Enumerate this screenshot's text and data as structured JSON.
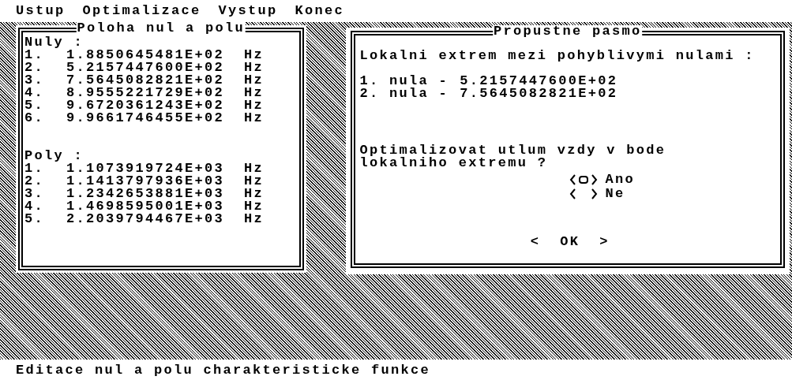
{
  "menu": [
    {
      "label": "Ustup"
    },
    {
      "label": "Optimalizace"
    },
    {
      "label": "Vystup"
    },
    {
      "label": "Konec"
    }
  ],
  "panel": {
    "title": "Poloha nul a polu",
    "sections": [
      {
        "heading": "Nuly :",
        "rows": [
          {
            "index": "1.",
            "value": "1.8850645481E+02",
            "unit": "Hz"
          },
          {
            "index": "2.",
            "value": "5.2157447600E+02",
            "unit": "Hz"
          },
          {
            "index": "3.",
            "value": "7.5645082821E+02",
            "unit": "Hz"
          },
          {
            "index": "4.",
            "value": "8.9555221729E+02",
            "unit": "Hz"
          },
          {
            "index": "5.",
            "value": "9.6720361243E+02",
            "unit": "Hz"
          },
          {
            "index": "6.",
            "value": "9.9661746455E+02",
            "unit": "Hz"
          }
        ]
      },
      {
        "heading": "Poly :",
        "rows": [
          {
            "index": "1.",
            "value": "1.1073919724E+03",
            "unit": "Hz"
          },
          {
            "index": "2.",
            "value": "1.1413797936E+03",
            "unit": "Hz"
          },
          {
            "index": "3.",
            "value": "1.2342653881E+03",
            "unit": "Hz"
          },
          {
            "index": "4.",
            "value": "1.4698595001E+03",
            "unit": "Hz"
          },
          {
            "index": "5.",
            "value": "2.2039794467E+03",
            "unit": "Hz"
          }
        ]
      }
    ]
  },
  "dialog": {
    "title": "Propustne pasmo",
    "message": "Lokalni extrem mezi pohyblivymi nulami :",
    "lines": [
      {
        "label": "1. nula -",
        "value": "5.2157447600E+02"
      },
      {
        "label": "2. nula -",
        "value": "7.5645082821E+02"
      }
    ],
    "question": "Optimalizovat utlum vzdy v bode\nlokalniho extremu ?",
    "options": [
      {
        "label": "Ano",
        "selected": true
      },
      {
        "label": "Ne",
        "selected": false
      }
    ],
    "button": "<  OK  >"
  },
  "status_bar": "Editace nul a polu charakteristicke funkce"
}
